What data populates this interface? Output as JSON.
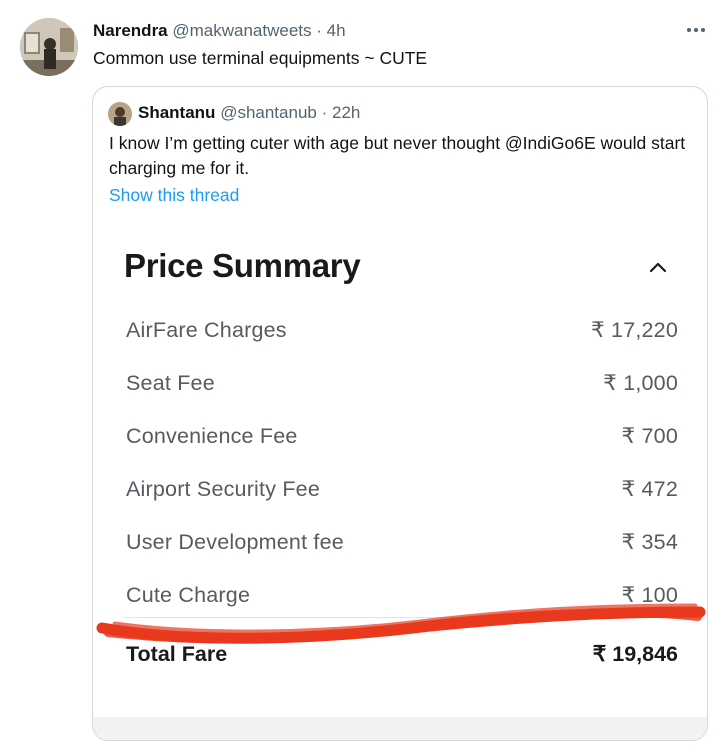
{
  "tweet": {
    "author_name": "Narendra",
    "author_handle": "@makwanatweets",
    "separator": "·",
    "time": "4h",
    "text": "Common use terminal equipments ~ CUTE",
    "more_icon": "more-horizontal-icon"
  },
  "quote": {
    "author_name": "Shantanu",
    "author_handle": "@shantanub",
    "separator": "·",
    "time": "22h",
    "text": "I know I’m getting cuter with age but never thought @IndiGo6E would start charging me for it.",
    "show_thread": "Show this thread",
    "link_color": "#1d9bf0"
  },
  "price_summary": {
    "title": "Price Summary",
    "collapse_icon": "chevron-up-icon",
    "rows": [
      {
        "label": "AirFare Charges",
        "value": "₹ 17,220"
      },
      {
        "label": "Seat Fee",
        "value": "₹ 1,000"
      },
      {
        "label": "Convenience Fee",
        "value": "₹ 700"
      },
      {
        "label": "Airport Security Fee",
        "value": "₹ 472"
      },
      {
        "label": "User Development fee",
        "value": "₹ 354"
      },
      {
        "label": "Cute Charge",
        "value": "₹ 100"
      }
    ],
    "total_label": "Total Fare",
    "total_value": "₹ 19,846",
    "highlight_color": "#e8391e"
  }
}
